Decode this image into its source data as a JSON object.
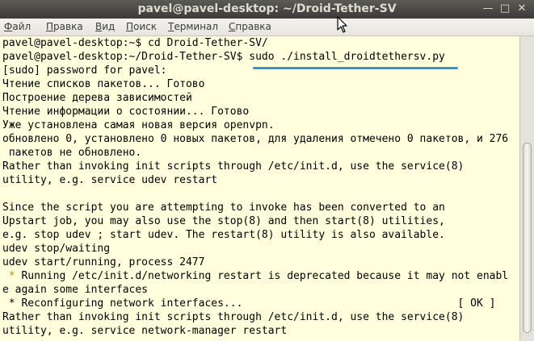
{
  "window": {
    "title": "pavel@pavel-desktop: ~/Droid-Tether-SV",
    "buttons": {
      "minimize_glyph": "—",
      "maximize_glyph": "□",
      "close_glyph": "✕"
    }
  },
  "menu": {
    "items": [
      {
        "mnemonic": "Ф",
        "rest": "айл"
      },
      {
        "mnemonic": "П",
        "rest": "равка"
      },
      {
        "mnemonic": "В",
        "rest": "ид"
      },
      {
        "mnemonic": "П",
        "rest": "оиск"
      },
      {
        "mnemonic": "Т",
        "rest": "ерминал"
      },
      {
        "mnemonic": "С",
        "rest": "правка"
      }
    ]
  },
  "terminal": {
    "line_0": "pavel@pavel-desktop:~$ cd Droid-Tether-SV/",
    "line_1": "pavel@pavel-desktop:~/Droid-Tether-SV$ sudo ./install_droidtethersv.py",
    "line_2": "[sudo] password for pavel:",
    "line_3": "Чтение списков пакетов... Готово",
    "line_4": "Построение дерева зависимостей",
    "line_5": "Чтение информации о состоянии... Готово",
    "line_6": "Уже установлена самая новая версия openvpn.",
    "line_7": "обновлено 0, установлено 0 новых пакетов, для удаления отмечено 0 пакетов, и 276",
    "line_8": " пакетов не обновлено.",
    "line_9": "Rather than invoking init scripts through /etc/init.d, use the service(8)",
    "line_10": "utility, e.g. service udev restart",
    "line_11": "",
    "line_12": "Since the script you are attempting to invoke has been converted to an",
    "line_13": "Upstart job, you may also use the stop(8) and then start(8) utilities,",
    "line_14": "e.g. stop udev ; start udev. The restart(8) utility is also available.",
    "line_15": "udev stop/waiting",
    "line_16": "udev start/running, process 2477",
    "line_17_star": " *",
    "line_17_text": " Running /etc/init.d/networking restart is deprecated because it may not enabl",
    "line_18": "e again some interfaces",
    "line_19": " * Reconfiguring network interfaces...                                  [ OK ]",
    "line_20": "Rather than invoking init scripts through /etc/init.d, use the service(8)",
    "line_21": "utility, e.g. service network-manager restart"
  }
}
